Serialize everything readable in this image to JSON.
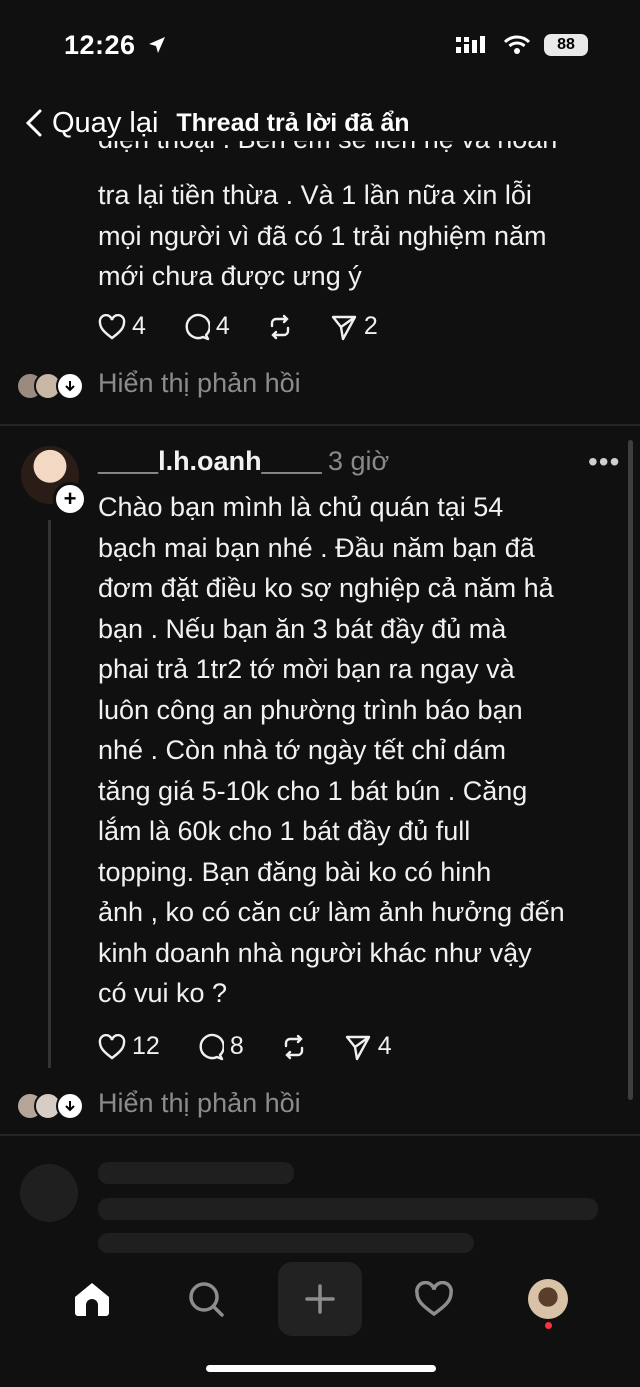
{
  "status_bar": {
    "time": "12:26",
    "battery": "88"
  },
  "nav": {
    "back_label": "Quay lại",
    "title": "Thread trả lời đã ẩn"
  },
  "post1": {
    "clipped_line": "điện thoại . Bên em sẽ liên hệ và hoàn",
    "lines": [
      "tra lại tiền thừa . Và 1 lần nữa xin lỗi",
      "mọi người vì đã có 1 trải nghiệm năm",
      "mới chưa được ưng ý"
    ],
    "likes": "4",
    "comments": "4",
    "shares": "2",
    "show_replies": "Hiển thị phản hồi"
  },
  "post2": {
    "username": "____l.h.oanh____",
    "time": "3 giờ",
    "more": "•••",
    "lines": [
      "Chào bạn mình là chủ quán tại 54",
      "bạch mai bạn nhé . Đầu năm bạn đã",
      "đơm đặt điều ko sợ nghiệp cả năm hả",
      "bạn . Nếu bạn ăn 3 bát đầy đủ mà",
      "phai trả 1tr2 tớ mời bạn ra ngay và",
      "luôn công an phường trình báo bạn",
      "nhé . Còn nhà tớ ngày tết chỉ dám",
      "tăng giá 5-10k cho 1 bát bún . Căng",
      "lắm là 60k cho 1 bát đầy đủ full",
      "topping. Bạn đăng bài ko có hinh",
      "ảnh , ko có căn cứ làm ảnh hưởng đến",
      "kinh doanh nhà người khác như vậy",
      "có vui ko ?"
    ],
    "likes": "12",
    "comments": "8",
    "shares": "4",
    "show_replies": "Hiển thị phản hồi"
  },
  "tabbar": {
    "items": [
      "home-icon",
      "search-icon",
      "plus-icon",
      "heart-icon",
      "profile-avatar"
    ]
  },
  "colors": {
    "background": "#101010",
    "text": "#f3f3f3",
    "muted": "#8c8c8c",
    "notif": "#ff3040"
  }
}
